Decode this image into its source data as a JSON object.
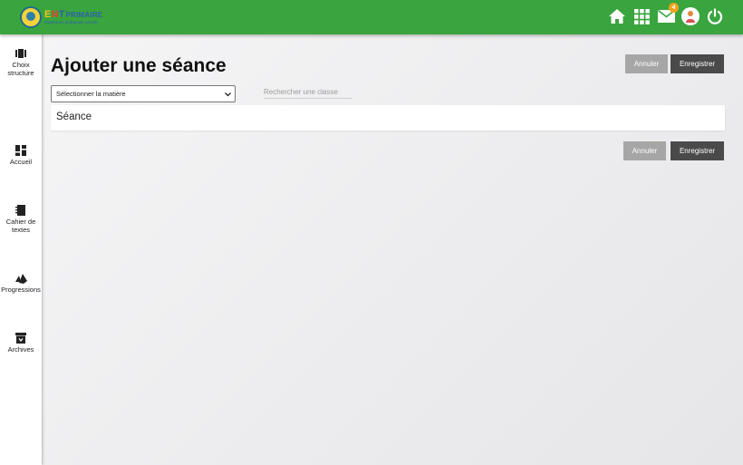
{
  "header": {
    "logo": {
      "part1": "E",
      "part2": "N",
      "part3": "T",
      "part4": "PRIMAIRE",
      "tagline": "Espérance pédagogie grandir"
    },
    "icons": [
      "home-icon",
      "apps-grid-icon",
      "mail-icon",
      "user-avatar-icon",
      "power-icon"
    ],
    "mail_badge": "4"
  },
  "sidebar": {
    "items": [
      {
        "label": "Choix structure",
        "icon": "structure-icon"
      },
      {
        "label": "Accueil",
        "icon": "dashboard-icon"
      },
      {
        "label": "Cahier de textes",
        "icon": "notebook-icon"
      },
      {
        "label": "Progressions",
        "icon": "progress-icon"
      },
      {
        "label": "Archives",
        "icon": "archive-icon"
      }
    ]
  },
  "main": {
    "title": "Ajouter une séance",
    "cancel_label": "Annuler",
    "save_label": "Enregistrer",
    "subject_select": {
      "selected": "Sélectionner la matière"
    },
    "class_search": {
      "placeholder": "Rechercher une classe",
      "value": ""
    },
    "panel_title": "Séance"
  },
  "colors": {
    "header_bg": "#3aa53f",
    "cancel_bg": "#a6a6a6",
    "save_bg": "#4a4a4a",
    "badge": "#f3a21b"
  }
}
